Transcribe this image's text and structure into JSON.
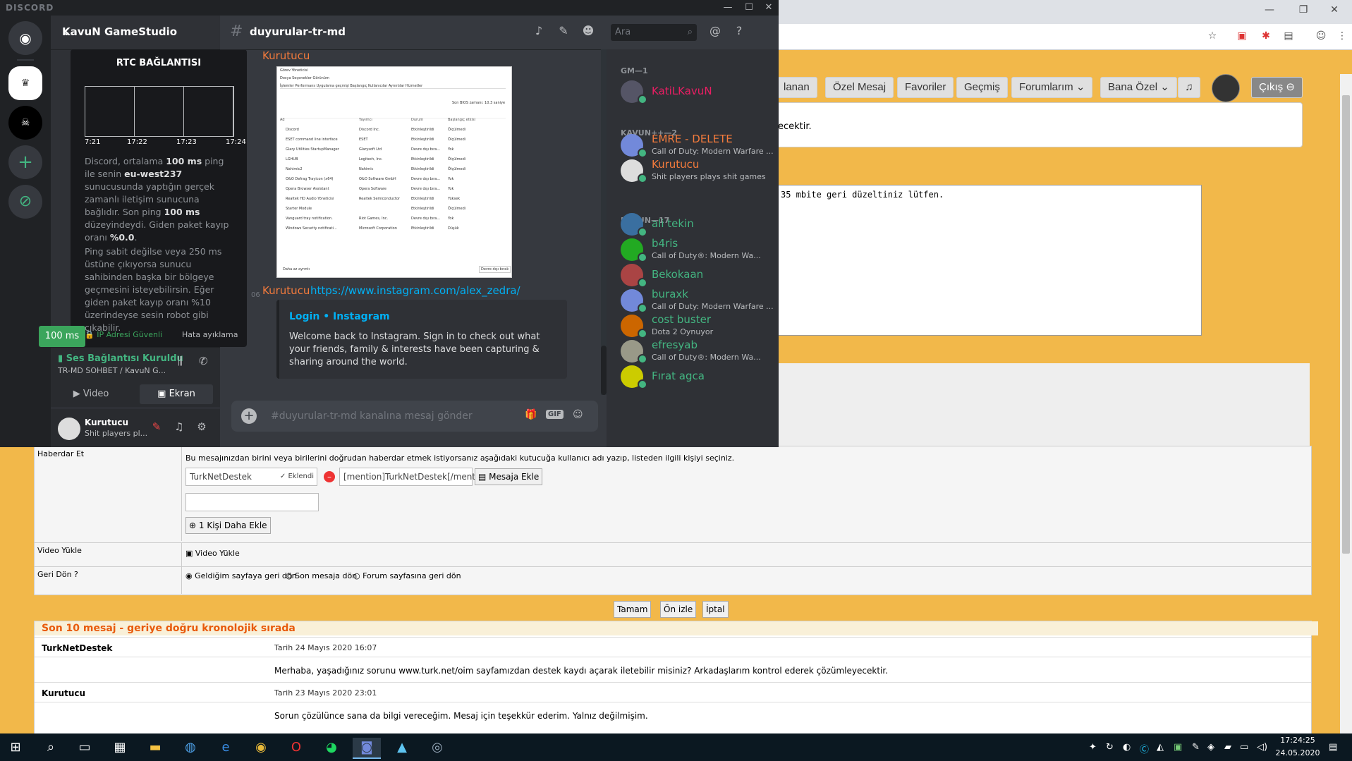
{
  "discord": {
    "brand": "DISCORD",
    "server_name": "KavuN GameStudio",
    "channel_name": "duyurular-tr-md",
    "search_placeholder": "Ara",
    "rtc": {
      "title": "RTC BAĞLANTISI",
      "ticks": [
        "7:21",
        "17:22",
        "17:23",
        "17:24"
      ],
      "desc_1": "Discord, ortalama ",
      "ping_avg": "100 ms",
      "desc_2": " ping ile senin ",
      "server": "eu-west237",
      "desc_3": " sunucusunda yaptığın gerçek zamanlı iletişim sunucuna bağlıdır. Son ping ",
      "ping_last": "100 ms",
      "desc_4": " düzeyindeydi. Giden paket kayıp oranı ",
      "loss": "%0.0",
      "desc_5": ".",
      "desc_6": "Ping sabit değilse veya 250 ms üstüne çıkıyorsa sunucu sahibinden başka bir bölgeye geçmesini isteyebilirsin. Eğer giden paket kayıp oranı %10 üzerindeyse sesin robot gibi çıkabilir.",
      "ip_safe": "IP Adresi Güvenli",
      "error_label": "Hata ayıklama",
      "ping_pill": "100 ms"
    },
    "voice": {
      "status": "Ses Bağlantısı Kuruldu",
      "channel": "TR-MD SOHBET / KavuN G...",
      "video_label": "Video",
      "screen_label": "Ekran"
    },
    "user": {
      "name": "Kurutucu",
      "status": "Shit players pl..."
    },
    "messages": {
      "author_1": "Kurutucu",
      "author_2": "Kurutucu",
      "time_prefix": "06",
      "link": "https://www.instagram.com/alex_zedra/",
      "embed_title": "Login • Instagram",
      "embed_desc": "Welcome back to Instagram. Sign in to check out what your friends, family & interests have been capturing & sharing around the world."
    },
    "input_placeholder": "#duyurular-tr-md kanalına mesaj gönder",
    "input_gif": "GIF",
    "members": {
      "cat_gm": "GM—1",
      "cat_kavunpp": "KAVUN++—2",
      "cat_kavun": "KAVUN—17",
      "list": [
        {
          "name": "KatiLKavuN",
          "activity": "",
          "color": "#e91e63"
        },
        {
          "name": "EMRE - DELETE",
          "activity": "Call of Duty: Modern Warfare ...",
          "color": "#f47b3c"
        },
        {
          "name": "Kurutucu",
          "activity": "Shit players plays shit games",
          "color": "#f47b3c"
        },
        {
          "name": "ali tekin",
          "activity": "",
          "color": "#43b581"
        },
        {
          "name": "b4ris",
          "activity": "Call of Duty®: Modern Wa...",
          "color": "#43b581"
        },
        {
          "name": "Bekokaan",
          "activity": "",
          "color": "#43b581"
        },
        {
          "name": "buraxk",
          "activity": "Call of Duty: Modern Warfare ...",
          "color": "#43b581"
        },
        {
          "name": "cost buster",
          "activity": "Dota 2 Oynuyor",
          "color": "#43b581"
        },
        {
          "name": "efresyab",
          "activity": "Call of Duty®: Modern Wa...",
          "color": "#43b581"
        },
        {
          "name": "Fırat agca",
          "activity": "",
          "color": "#43b581"
        }
      ]
    },
    "embedded_screenshot": {
      "title": "Görev Yöneticisi",
      "menu": "Dosya   Seçenekler   Görünüm",
      "tabs": "İşlemler  Performans  Uygulama geçmişi  Başlangıç  Kullanıcılar  Ayrıntılar  Hizmetler",
      "bios": "Son BIOS zamanı:  10.3 saniye",
      "headers": [
        "Ad",
        "Yayımcı",
        "Durum",
        "Başlangıç etkisi"
      ],
      "rows": [
        [
          "Discord",
          "Discord Inc.",
          "Etkinleştirildi",
          "Ölçülmedi"
        ],
        [
          "ESET command line interface",
          "ESET",
          "Etkinleştirildi",
          "Ölçülmedi"
        ],
        [
          "Glary Utilities StartupManager",
          "Glarysoft Ltd",
          "Devre dışı bıra...",
          "Yok"
        ],
        [
          "LGHUB",
          "Logitech, Inc.",
          "Etkinleştirildi",
          "Ölçülmedi"
        ],
        [
          "Nahimic2",
          "Nahimic",
          "Etkinleştirildi",
          "Ölçülmedi"
        ],
        [
          "O&O Defrag Trayicon (x64)",
          "O&O Software GmbH",
          "Devre dışı bıra...",
          "Yok"
        ],
        [
          "Opera Browser Assistant",
          "Opera Software",
          "Devre dışı bıra...",
          "Yok"
        ],
        [
          "Realtek HD Audio Yöneticisi",
          "Realtek Semiconductor",
          "Etkinleştirildi",
          "Yüksek"
        ],
        [
          "Starter Module",
          "",
          "Etkinleştirildi",
          "Ölçülmedi"
        ],
        [
          "Vanguard tray notification.",
          "Riot Games, Inc.",
          "Devre dışı bıra...",
          "Yok"
        ],
        [
          "Windows Security notificati...",
          "Microsoft Corporation",
          "Etkinleştirildi",
          "Düşük"
        ]
      ],
      "less": "Daha az ayrıntı",
      "disable": "Devre dışı bırak"
    }
  },
  "browser": {
    "nav": [
      "lanan",
      "Özel Mesaj",
      "Favoriler",
      "Geçmiş",
      "Forumlarım",
      "Bana Özel",
      "Çıkış"
    ],
    "quote_tail": "ecektir.",
    "editor_text": "35 mbite geri düzeltiniz lütfen.",
    "haberdar": {
      "label": "Haberdar Et",
      "hint": "Bu mesajınızdan birini veya birilerini doğrudan haberdar etmek istiyorsanız aşağıdaki kutucuğa kullanıcı adı yazıp, listeden ilgili kişiyi seçiniz.",
      "user": "TurkNetDestek",
      "added": "Eklendi",
      "mention": "[mention]TurkNetDestek[/mention]",
      "add_to_msg": "Mesaja Ekle",
      "add_more": "1 Kişi Daha Ekle"
    },
    "video": {
      "label": "Video Yükle",
      "button": "Video Yükle"
    },
    "geri": {
      "label": "Geri Dön ?",
      "opt1": "Geldiğim sayfaya geri dön",
      "opt2": "Son mesaja dön",
      "opt3": "Forum sayfasına geri dön"
    },
    "buttons": {
      "ok": "Tamam",
      "preview": "Ön izle",
      "cancel": "İptal"
    },
    "last": {
      "title": "Son 10 mesaj - geriye doğru kronolojik sırada",
      "posts": [
        {
          "user": "TurkNetDestek",
          "date": "Tarih 24 Mayıs 2020 16:07",
          "text": "Merhaba, yaşadığınız sorunu www.turk.net/oim sayfamızdan destek kaydı açarak iletebilir misiniz? Arkadaşlarım kontrol ederek çözümleyecektir."
        },
        {
          "user": "Kurutucu",
          "date": "Tarih 23 Mayıs 2020 23:01",
          "text": "Sorun çözülünce sana da bilgi vereceğim. Mesaj için teşekkür ederim. Yalnız değilmişim."
        }
      ]
    }
  },
  "taskbar": {
    "time": "17:24:25",
    "date": "24.05.2020"
  },
  "colors": {
    "discord_bg": "#36393f",
    "forum_bg": "#f2b84a",
    "accent_green": "#43b581",
    "accent_orange": "#f47b3c",
    "link_blue": "#00b0f4"
  }
}
